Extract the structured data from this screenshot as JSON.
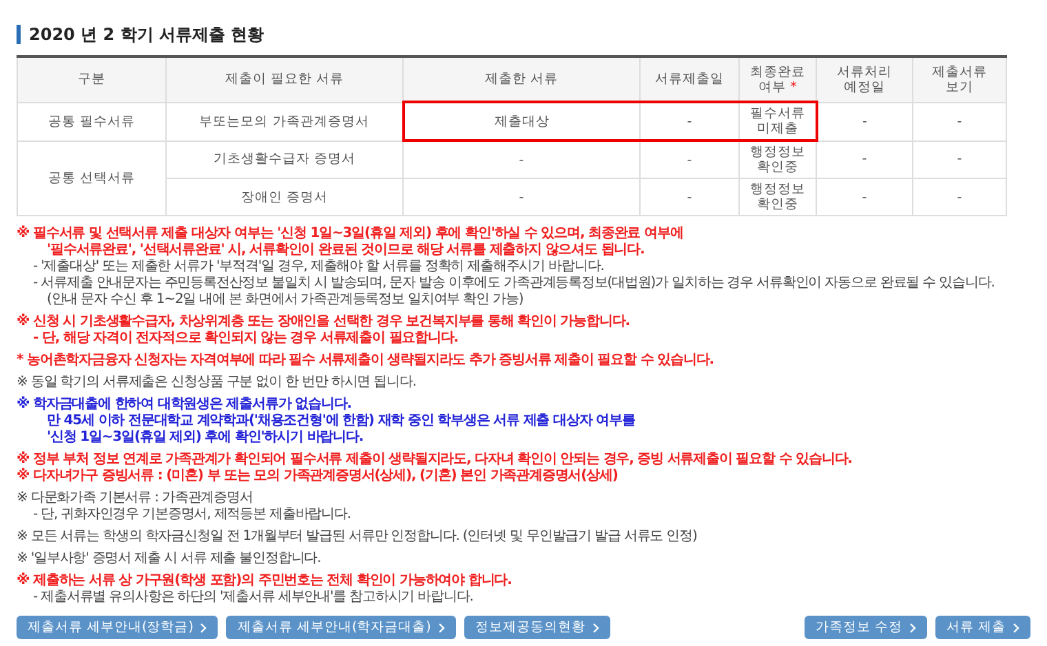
{
  "title": "2020 년 2 학기 서류제출 현황",
  "table": {
    "columns": [
      {
        "label": "구분"
      },
      {
        "label": "제출이 필요한 서류"
      },
      {
        "label": "제출한 서류"
      },
      {
        "label": "서류제출일"
      },
      {
        "label": "최종완료\n여부",
        "mark": "*"
      },
      {
        "label": "서류처리\n예정일"
      },
      {
        "label": "제출서류\n보기"
      }
    ],
    "groups": [
      {
        "category": "공통 필수서류",
        "rows": [
          {
            "cells": [
              {
                "text": "부또는모의 가족관계증명서",
                "highlighted": false
              },
              {
                "text": "제출대상",
                "highlighted": true
              },
              {
                "text": "-",
                "highlighted": true
              },
              {
                "text": "필수서류\n미제출",
                "highlighted": true
              },
              {
                "text": "-",
                "highlighted": false
              },
              {
                "text": "-",
                "highlighted": false
              }
            ]
          }
        ]
      },
      {
        "category": "공통 선택서류",
        "rows": [
          {
            "cells": [
              {
                "text": "기초생활수급자 증명서",
                "highlighted": false
              },
              {
                "text": "-",
                "highlighted": false
              },
              {
                "text": "-",
                "highlighted": false
              },
              {
                "text": "행정정보\n확인중",
                "highlighted": false
              },
              {
                "text": "-",
                "highlighted": false
              },
              {
                "text": "-",
                "highlighted": false
              }
            ]
          },
          {
            "cells": [
              {
                "text": "장애인 증명서",
                "highlighted": false
              },
              {
                "text": "-",
                "highlighted": false
              },
              {
                "text": "-",
                "highlighted": false
              },
              {
                "text": "행정정보\n확인중",
                "highlighted": false
              },
              {
                "text": "-",
                "highlighted": false
              },
              {
                "text": "-",
                "highlighted": false
              }
            ]
          }
        ]
      }
    ]
  },
  "notes": [
    {
      "lines": [
        {
          "text": "※ 필수서류 및 선택서류 제출 대상자 여부는 '신청 1일~3일(휴일 제외) 후에 확인'하실 수 있으며, 최종완료 여부에",
          "color": "#f02020",
          "emphasized": true,
          "kind": "head"
        },
        {
          "text": "'필수서류완료', '선택서류완료' 시, 서류확인이 완료된 것이므로 해당 서류를 제출하지 않으셔도 됩니다.",
          "color": "#f02020",
          "emphasized": true,
          "kind": "cont"
        },
        {
          "text": "- '제출대상' 또는 제출한 서류가 '부적격'일 경우, 제출해야 할 서류를 정확히 제출해주시기 바랍니다.",
          "color": "#444444",
          "emphasized": false,
          "kind": "dash"
        },
        {
          "text": "- 서류제출 안내문자는 주민등록전산정보 불일치 시 발송되며, 문자 발송 이후에도 가족관계등록정보(대법원)가 일치하는 경우 서류확인이 자동으로 완료될 수 있습니다.",
          "color": "#444444",
          "emphasized": false,
          "kind": "dash"
        },
        {
          "text": "(안내 문자 수신 후 1~2일 내에 본 화면에서 가족관계등록정보 일치여부 확인 가능)",
          "color": "#444444",
          "emphasized": false,
          "kind": "cont"
        }
      ]
    },
    {
      "lines": [
        {
          "text": "※ 신청 시 기초생활수급자, 차상위계층 또는 장애인을 선택한 경우 보건복지부를 통해 확인이 가능합니다.",
          "color": "#f02020",
          "emphasized": true,
          "kind": "head"
        },
        {
          "text": "- 단, 해당 자격이 전자적으로 확인되지 않는 경우 서류제출이 필요합니다.",
          "color": "#f02020",
          "emphasized": true,
          "kind": "dash"
        }
      ]
    },
    {
      "lines": [
        {
          "text": "* 농어촌학자금융자 신청자는 자격여부에 따라 필수 서류제출이 생략될지라도 추가 증빙서류 제출이 필요할 수 있습니다.",
          "color": "#f02020",
          "emphasized": true,
          "kind": "head"
        }
      ]
    },
    {
      "lines": [
        {
          "text": "※ 동일 학기의 서류제출은 신청상품 구분 없이 한 번만 하시면 됩니다.",
          "color": "#444444",
          "emphasized": false,
          "kind": "head"
        }
      ]
    },
    {
      "lines": [
        {
          "text": "※ 학자금대출에 한하여 대학원생은 제출서류가 없습니다.",
          "color": "#2323d8",
          "emphasized": true,
          "kind": "head"
        },
        {
          "text": "만 45세 이하 전문대학교 계약학과('채용조건형'에 한함) 재학 중인 학부생은 서류 제출 대상자 여부를",
          "color": "#2323d8",
          "emphasized": true,
          "kind": "cont"
        },
        {
          "text": "'신청 1일~3일(휴일 제외) 후에 확인'하시기 바랍니다.",
          "color": "#2323d8",
          "emphasized": true,
          "kind": "cont"
        }
      ]
    },
    {
      "lines": [
        {
          "text": "※ 정부 부처 정보 연계로 가족관계가 확인되어 필수서류 제출이 생략될지라도, 다자녀 확인이 안되는 경우, 증빙 서류제출이 필요할 수 있습니다.",
          "color": "#f02020",
          "emphasized": true,
          "kind": "head"
        },
        {
          "text": "※ 다자녀가구 증빙서류 : (미혼) 부 또는 모의 가족관계증명서(상세), (기혼) 본인 가족관계증명서(상세)",
          "color": "#f02020",
          "emphasized": true,
          "kind": "head"
        }
      ]
    },
    {
      "lines": [
        {
          "text": "※ 다문화가족 기본서류 : 가족관계증명서",
          "color": "#444444",
          "emphasized": false,
          "kind": "head"
        },
        {
          "text": "- 단, 귀화자인경우 기본증명서, 제적등본 제출바랍니다.",
          "color": "#444444",
          "emphasized": false,
          "kind": "dash"
        }
      ]
    },
    {
      "lines": [
        {
          "text": "※ 모든 서류는 학생의 학자금신청일 전 1개월부터 발급된 서류만 인정합니다. (인터넷 및 무인발급기 발급 서류도 인정)",
          "color": "#444444",
          "emphasized": false,
          "kind": "head"
        }
      ]
    },
    {
      "lines": [
        {
          "text": "※ '일부사항' 증명서 제출 시 서류 제출 불인정합니다.",
          "color": "#444444",
          "emphasized": false,
          "kind": "head"
        }
      ]
    },
    {
      "lines": [
        {
          "text": "※ 제출하는 서류 상 가구원(학생 포함)의 주민번호는 전체 확인이 가능하여야 합니다.",
          "color": "#f02020",
          "emphasized": true,
          "kind": "head"
        },
        {
          "text": "- 제출서류별 유의사항은 하단의 '제출서류 세부안내'를 참고하시기 바랍니다.",
          "color": "#444444",
          "emphasized": false,
          "kind": "dash"
        }
      ]
    }
  ],
  "buttons_left": [
    "제출서류 세부안내(장학금)",
    "제출서류 세부안내(학자금대출)",
    "정보제공동의현황"
  ],
  "buttons_right": [
    "가족정보 수정",
    "서류 제출"
  ]
}
